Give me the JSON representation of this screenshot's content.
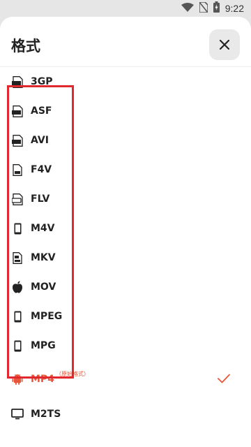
{
  "status_bar": {
    "time": "9:22",
    "icons": [
      "wifi-icon",
      "no-sim-icon",
      "battery-charging-icon"
    ]
  },
  "sheet": {
    "title": "格式",
    "close_icon": "close-icon"
  },
  "formats": [
    {
      "label": "3GP",
      "icon": "file-3gp-icon"
    },
    {
      "label": "ASF",
      "icon": "file-asf-icon"
    },
    {
      "label": "AVI",
      "icon": "file-avi-icon"
    },
    {
      "label": "F4V",
      "icon": "file-f4v-icon"
    },
    {
      "label": "FLV",
      "icon": "file-flv-icon"
    },
    {
      "label": "M4V",
      "icon": "phone-icon"
    },
    {
      "label": "MKV",
      "icon": "file-mkv-icon"
    },
    {
      "label": "MOV",
      "icon": "apple-icon"
    },
    {
      "label": "MPEG",
      "icon": "phone-icon"
    },
    {
      "label": "MPG",
      "icon": "phone-icon"
    },
    {
      "label": "MP4",
      "icon": "android-icon",
      "note": "（原始格式）",
      "selected": true
    },
    {
      "label": "M2TS",
      "icon": "monitor-icon"
    }
  ],
  "colors": {
    "accent": "#e8553a",
    "highlight_border": "#e0282e"
  }
}
